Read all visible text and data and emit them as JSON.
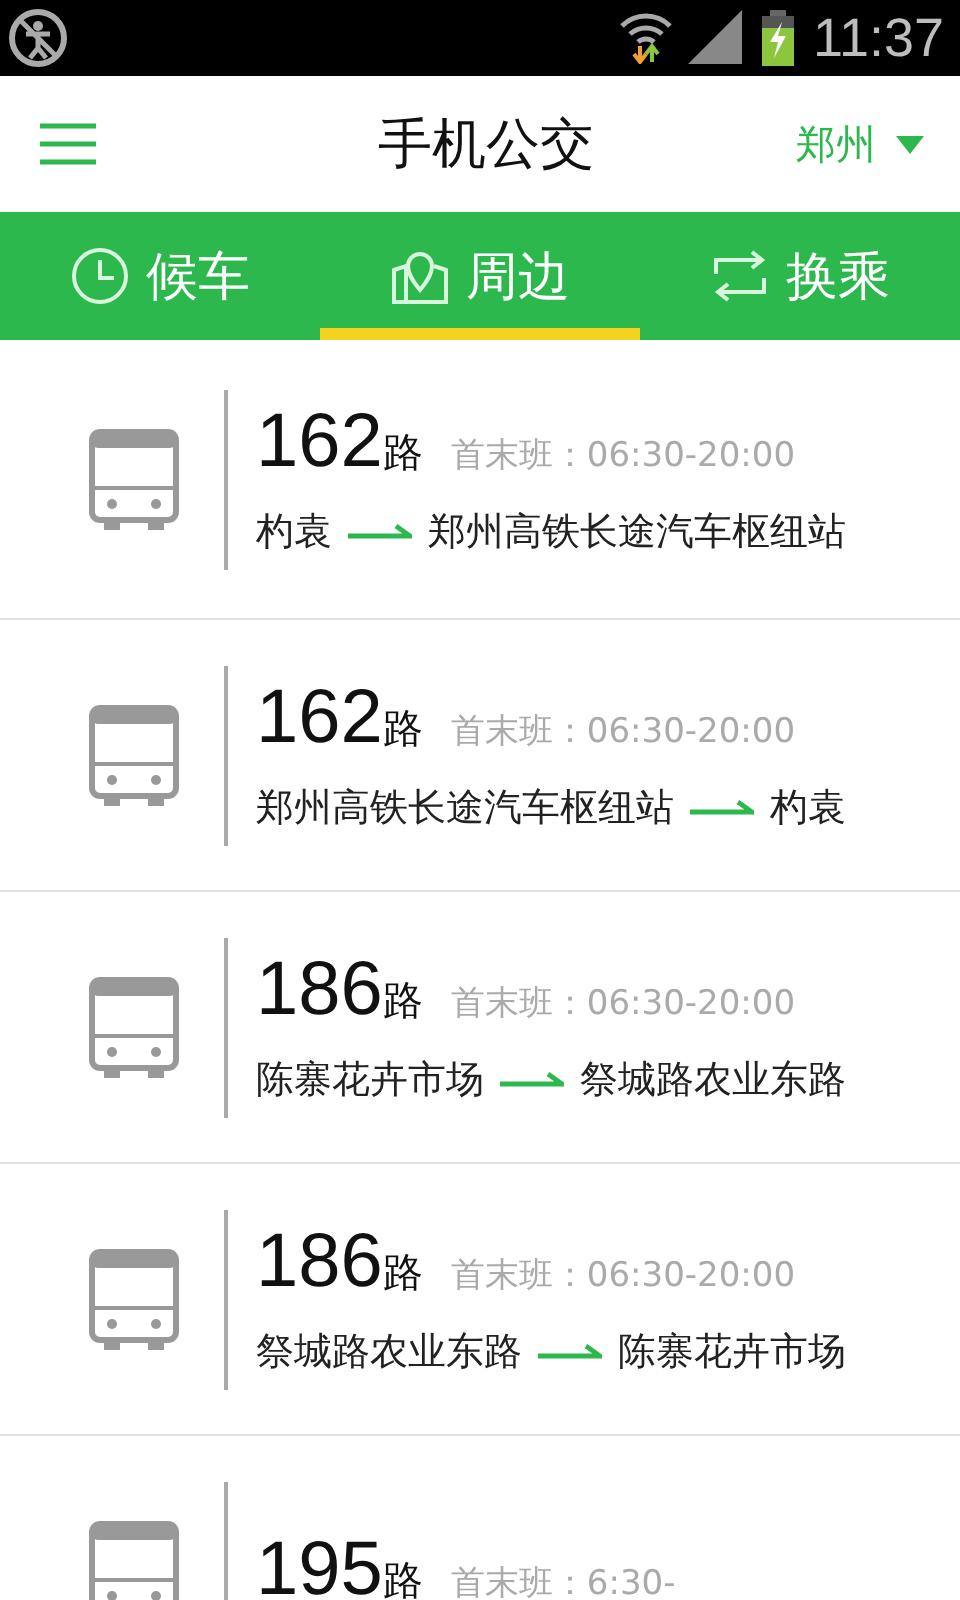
{
  "status_bar": {
    "time": "11:37"
  },
  "header": {
    "title": "手机公交",
    "city": "郑州"
  },
  "tabs": [
    {
      "label": "候车",
      "kind": "waiting",
      "selected": false
    },
    {
      "label": "周边",
      "kind": "nearby",
      "selected": true
    },
    {
      "label": "换乘",
      "kind": "transfer",
      "selected": false
    }
  ],
  "routes": [
    {
      "number": "162",
      "suffix": "路",
      "schedule": "首末班：06:30-20:00",
      "from": "杓袁",
      "to": "郑州高铁长途汽车枢纽站"
    },
    {
      "number": "162",
      "suffix": "路",
      "schedule": "首末班：06:30-20:00",
      "from": "郑州高铁长途汽车枢纽站",
      "to": "杓袁"
    },
    {
      "number": "186",
      "suffix": "路",
      "schedule": "首末班：06:30-20:00",
      "from": "陈寨花卉市场",
      "to": "祭城路农业东路"
    },
    {
      "number": "186",
      "suffix": "路",
      "schedule": "首末班：06:30-20:00",
      "from": "祭城路农业东路",
      "to": "陈寨花卉市场"
    },
    {
      "number": "195",
      "suffix": "路",
      "schedule": "首末班：6:30-"
    }
  ]
}
